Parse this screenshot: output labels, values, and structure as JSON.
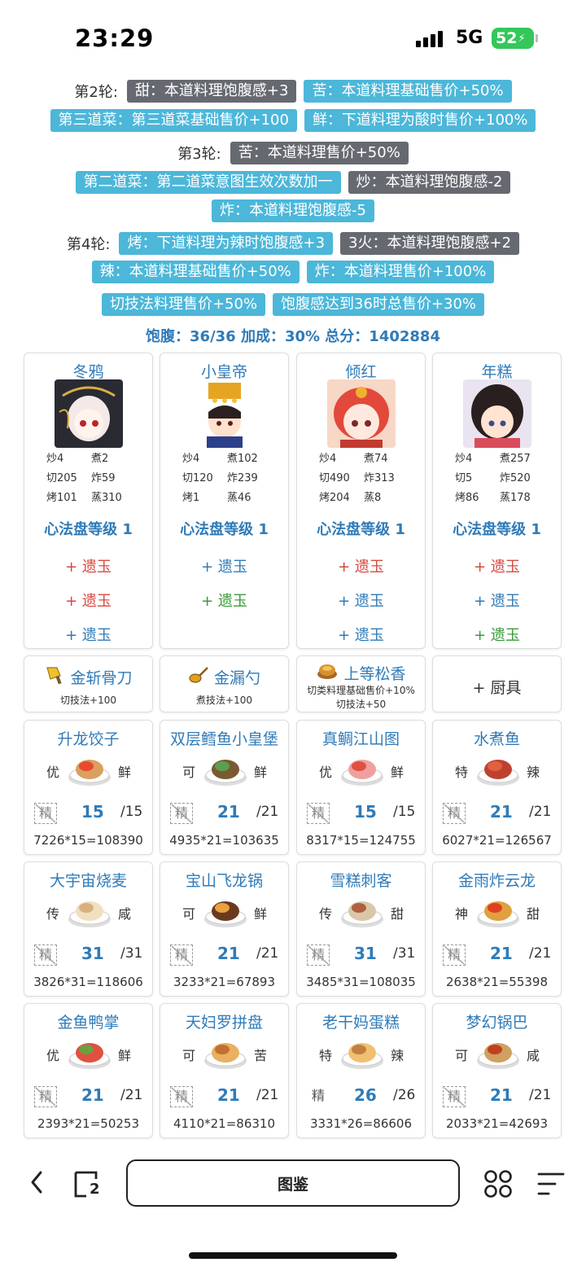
{
  "status": {
    "time": "23:29",
    "network": "5G",
    "battery": "52"
  },
  "buffs": {
    "r2_label": "第2轮:",
    "r2_t1": "甜：本道料理饱腹感+3",
    "r2_t2": "苦：本道料理基础售价+50%",
    "r2_t3": "第三道菜：第三道菜基础售价+100",
    "r2_t4": "鲜：下道料理为酸时售价+100%",
    "r3_label": "第3轮:",
    "r3_t1": "苦：本道料理售价+50%",
    "r3_t2": "第二道菜：第二道菜意图生效次数加一",
    "r3_t3": "炒：本道料理饱腹感-2",
    "r3_t4": "炸：本道料理饱腹感-5",
    "r4_label": "第4轮:",
    "r4_t1": "烤：下道料理为辣时饱腹感+3",
    "r4_t2": "3火：本道料理饱腹感+2",
    "r4_t3": "辣：本道料理基础售价+50%",
    "r4_t4": "炸：本道料理售价+100%",
    "r4_t5": "切技法料理售价+50%",
    "r4_t6": "饱腹感达到36时总售价+30%"
  },
  "summary": "饱腹：36/36 加成：30% 总分：1402884",
  "chefs": [
    {
      "name": "冬鸦",
      "s1": "炒4",
      "s2": "煮2",
      "s3": "切205",
      "s4": "炸59",
      "s5": "烤101",
      "s6": "蒸310",
      "level": "心法盘等级 1",
      "j1": "+ 遗玉",
      "j2": "+ 遗玉",
      "j3": "+ 遗玉"
    },
    {
      "name": "小皇帝",
      "s1": "炒4",
      "s2": "煮102",
      "s3": "切120",
      "s4": "炸239",
      "s5": "烤1",
      "s6": "蒸46",
      "level": "心法盘等级 1",
      "j1": "+ 遗玉",
      "j2": "+ 遗玉"
    },
    {
      "name": "倾红",
      "s1": "炒4",
      "s2": "煮74",
      "s3": "切490",
      "s4": "炸313",
      "s5": "烤204",
      "s6": "蒸8",
      "level": "心法盘等级 1",
      "j1": "+ 遗玉",
      "j2": "+ 遗玉",
      "j3": "+ 遗玉"
    },
    {
      "name": "年糕",
      "s1": "炒4",
      "s2": "煮257",
      "s3": "切5",
      "s4": "炸520",
      "s5": "烤86",
      "s6": "蒸178",
      "level": "心法盘等级 1",
      "j1": "+ 遗玉",
      "j2": "+ 遗玉",
      "j3": "+ 遗玉"
    }
  ],
  "equipment": [
    {
      "name": "金斩骨刀",
      "desc1": "切技法+100",
      "icon": "cleaver-icon"
    },
    {
      "name": "金漏勺",
      "desc1": "煮技法+100",
      "icon": "ladle-icon"
    },
    {
      "name": "上等松香",
      "desc1": "切类料理基础售价+10%",
      "desc2": "切技法+50",
      "icon": "rosin-icon"
    },
    {
      "name": "+ 厨具"
    }
  ],
  "dishes": [
    {
      "name": "升龙饺子",
      "rarity": "优",
      "taste": "鲜",
      "jing": "精",
      "count": "15",
      "max": "/15",
      "formula": "7226*15=108390"
    },
    {
      "name": "双层鳕鱼小皇堡",
      "rarity": "可",
      "taste": "鲜",
      "jing": "精",
      "count": "21",
      "max": "/21",
      "formula": "4935*21=103635"
    },
    {
      "name": "真鲷江山图",
      "rarity": "优",
      "taste": "鲜",
      "jing": "精",
      "count": "15",
      "max": "/15",
      "formula": "8317*15=124755"
    },
    {
      "name": "水煮鱼",
      "rarity": "特",
      "taste": "辣",
      "jing": "精",
      "count": "21",
      "max": "/21",
      "formula": "6027*21=126567"
    },
    {
      "name": "大宇宙烧麦",
      "rarity": "传",
      "taste": "咸",
      "jing": "精",
      "count": "31",
      "max": "/31",
      "formula": "3826*31=118606"
    },
    {
      "name": "宝山飞龙锅",
      "rarity": "可",
      "taste": "鲜",
      "jing": "精",
      "count": "21",
      "max": "/21",
      "formula": "3233*21=67893"
    },
    {
      "name": "雪糕刺客",
      "rarity": "传",
      "taste": "甜",
      "jing": "精",
      "count": "31",
      "max": "/31",
      "formula": "3485*31=108035"
    },
    {
      "name": "金雨炸云龙",
      "rarity": "神",
      "taste": "甜",
      "jing": "精",
      "count": "21",
      "max": "/21",
      "formula": "2638*21=55398"
    },
    {
      "name": "金鱼鸭掌",
      "rarity": "优",
      "taste": "鲜",
      "jing": "精",
      "count": "21",
      "max": "/21",
      "formula": "2393*21=50253"
    },
    {
      "name": "天妇罗拼盘",
      "rarity": "可",
      "taste": "苦",
      "jing": "精",
      "count": "21",
      "max": "/21",
      "formula": "4110*21=86310"
    },
    {
      "name": "老干妈蛋糕",
      "rarity": "特",
      "taste": "辣",
      "jing": "精",
      "count": "26",
      "max": "/26",
      "formula": "3331*26=86606"
    },
    {
      "name": "梦幻锅巴",
      "rarity": "可",
      "taste": "咸",
      "jing": "精",
      "count": "21",
      "max": "/21",
      "formula": "2033*21=42693"
    }
  ],
  "bottom": {
    "gallery_label": "图鉴",
    "tabs_count": "2"
  },
  "colors": {
    "accent_blue": "#2f7bb8",
    "tag_blue": "#4cb7d9",
    "tag_gray": "#666a70",
    "jade_red": "#d9473f",
    "jade_green": "#3a9b3a"
  }
}
